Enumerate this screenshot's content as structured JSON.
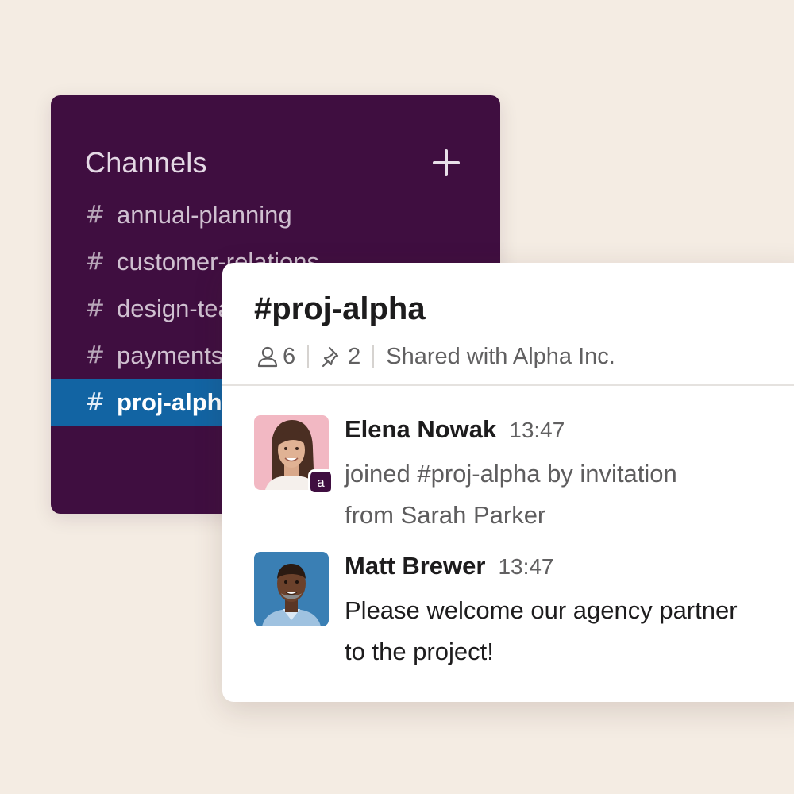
{
  "sidebar": {
    "title": "Channels",
    "add_icon": "plus-icon",
    "channels": [
      {
        "hash": "#",
        "name": "annual-planning",
        "active": false
      },
      {
        "hash": "#",
        "name": "customer-relations",
        "active": false
      },
      {
        "hash": "#",
        "name": "design-team",
        "active": false
      },
      {
        "hash": "#",
        "name": "payments",
        "active": false
      },
      {
        "hash": "#",
        "name": "proj-alpha",
        "active": true
      }
    ],
    "colors": {
      "background": "#3f0e40",
      "active": "#1264a3"
    }
  },
  "channel": {
    "name": "#proj-alpha",
    "members_icon": "person-icon",
    "members_count": "6",
    "pins_icon": "pin-icon",
    "pins_count": "2",
    "shared_text": "Shared with Alpha Inc."
  },
  "messages": [
    {
      "author": "Elena Nowak",
      "time": "13:47",
      "text_line1": "joined #proj-alpha by invitation",
      "text_line2": "from Sarah Parker",
      "badge": "a",
      "avatar_icon": "avatar-photo"
    },
    {
      "author": "Matt Brewer",
      "time": "13:47",
      "text_line1": "Please welcome our agency partner",
      "text_line2": "to the project!",
      "avatar_icon": "avatar-photo"
    }
  ],
  "page": {
    "background": "#f4ece3"
  }
}
